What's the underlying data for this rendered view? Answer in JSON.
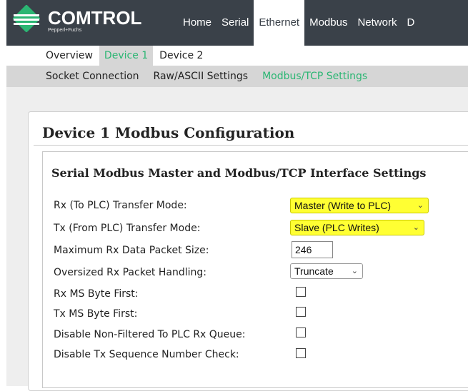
{
  "brand": {
    "name": "COMTROL",
    "sub": "Pepperl+Fuchs",
    "color": "#2bb673"
  },
  "nav": {
    "items": [
      {
        "label": "Home"
      },
      {
        "label": "Serial"
      },
      {
        "label": "Ethernet",
        "active": true
      },
      {
        "label": "Modbus"
      },
      {
        "label": "Network"
      },
      {
        "label": "D"
      }
    ]
  },
  "subnav": {
    "items": [
      {
        "label": "Overview"
      },
      {
        "label": "Device 1",
        "active": true
      },
      {
        "label": "Device 2"
      }
    ]
  },
  "subsubnav": {
    "items": [
      {
        "label": "Socket Connection"
      },
      {
        "label": "Raw/ASCII Settings"
      },
      {
        "label": "Modbus/TCP Settings",
        "active": true
      }
    ]
  },
  "page": {
    "title": "Device 1 Modbus Configuration",
    "section_title": "Serial Modbus Master and Modbus/TCP Interface Settings"
  },
  "fields": {
    "rx_mode": {
      "label": "Rx (To PLC) Transfer Mode:",
      "value": "Master (Write to PLC)"
    },
    "tx_mode": {
      "label": "Tx (From PLC) Transfer Mode:",
      "value": "Slave (PLC Writes)"
    },
    "max_rx": {
      "label": "Maximum Rx Data Packet Size:",
      "value": "246"
    },
    "oversized": {
      "label": "Oversized Rx Packet Handling:",
      "value": "Truncate"
    },
    "rx_ms_byte": {
      "label": "Rx MS Byte First:",
      "checked": false
    },
    "tx_ms_byte": {
      "label": "Tx MS Byte First:",
      "checked": false
    },
    "disable_nonfiltered": {
      "label": "Disable Non-Filtered To PLC Rx Queue:",
      "checked": false
    },
    "disable_tx_seq": {
      "label": "Disable Tx Sequence Number Check:",
      "checked": false
    }
  },
  "icons": {
    "dropdown": "chevron-down-icon",
    "checkbox": "checkbox-unchecked"
  }
}
